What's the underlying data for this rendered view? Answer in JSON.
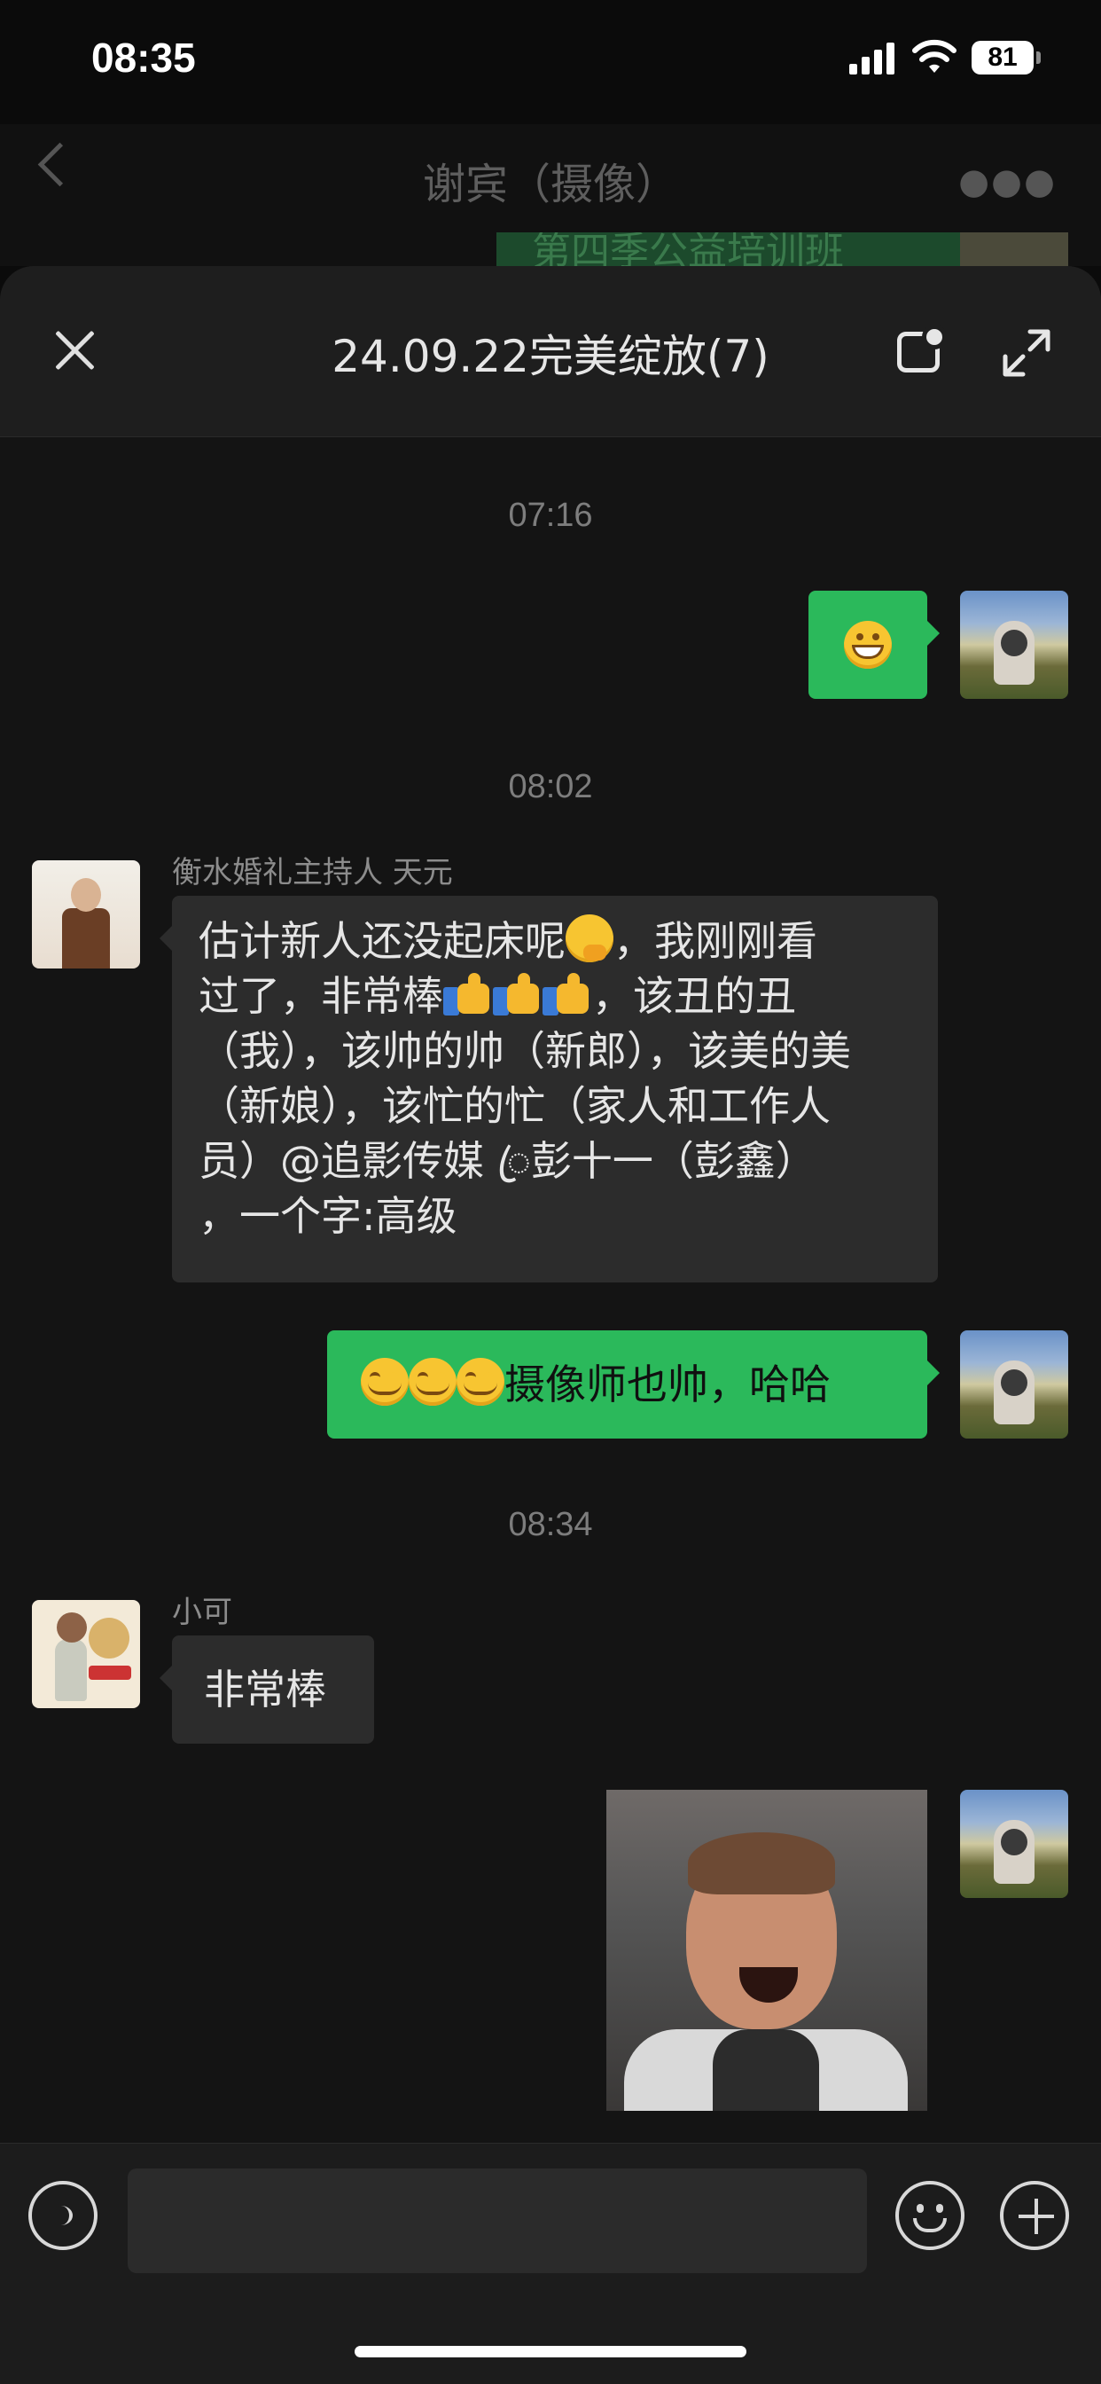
{
  "status_bar": {
    "time": "08:35",
    "battery": "81"
  },
  "background_chat": {
    "title": "谢宾（摄像）",
    "peek_text": "第四季公益培训班"
  },
  "sheet": {
    "title": "24.09.22完美绽放(7)"
  },
  "messages": [
    {
      "type": "time",
      "text": "07:16"
    },
    {
      "type": "emoji",
      "from": "self",
      "emoji": "grinning-face"
    },
    {
      "type": "time",
      "text": "08:02"
    },
    {
      "type": "text",
      "from": "衡水婚礼主持人 天元",
      "lines": [
        "估计新人还没起床呢",
        "，我刚刚看",
        "过了，非常棒",
        "，该丑的丑",
        "（我），该帅的帅（新郎），该美的美",
        "（新娘），该忙的忙（家人和工作人",
        "员）@追影传媒 ꦿ彭十一（彭鑫）",
        "，一个字:高级"
      ]
    },
    {
      "type": "text",
      "from": "self",
      "text": "摄像师也帅，哈哈"
    },
    {
      "type": "time",
      "text": "08:34"
    },
    {
      "type": "text",
      "from": "小可",
      "text": "非常棒"
    },
    {
      "type": "image",
      "from": "self",
      "description_icon": "laughing-man-sticker"
    }
  ],
  "input": {
    "placeholder": ""
  },
  "icons": [
    "back-icon",
    "more-icon",
    "close-icon",
    "float-window-icon",
    "expand-icon",
    "voice-icon",
    "emoji-icon",
    "plus-icon"
  ],
  "colors": {
    "self_bubble": "#2bb95b",
    "other_bubble": "#2c2c2c",
    "background": "#141414"
  }
}
